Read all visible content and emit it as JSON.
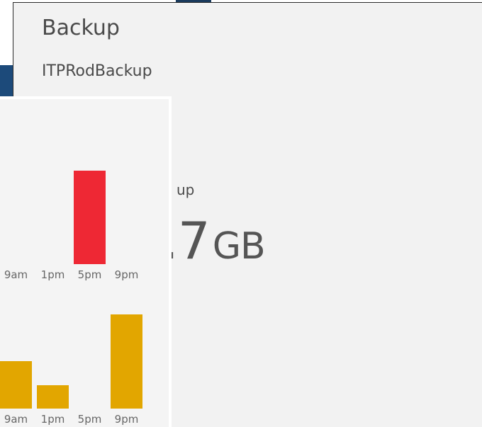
{
  "panel": {
    "title": "Backup",
    "subtitle": "ITPRodBackup",
    "stat_label": "up",
    "stat_value": ".7",
    "stat_unit": "GB"
  },
  "colors": {
    "chart1": "#ee2834",
    "chart2": "#e2a600",
    "panel_bg": "#f2f2f2",
    "accent_navy": "#1c4a7a"
  },
  "chart_data": [
    {
      "type": "bar",
      "categories": [
        "9am",
        "1pm",
        "5pm",
        "9pm"
      ],
      "values": [
        0,
        0,
        132,
        0
      ],
      "title": "",
      "xlabel": "",
      "ylabel": ""
    },
    {
      "type": "bar",
      "categories": [
        "9am",
        "1pm",
        "5pm",
        "9pm"
      ],
      "values": [
        67,
        33,
        0,
        133
      ],
      "title": "",
      "xlabel": "",
      "ylabel": ""
    }
  ]
}
